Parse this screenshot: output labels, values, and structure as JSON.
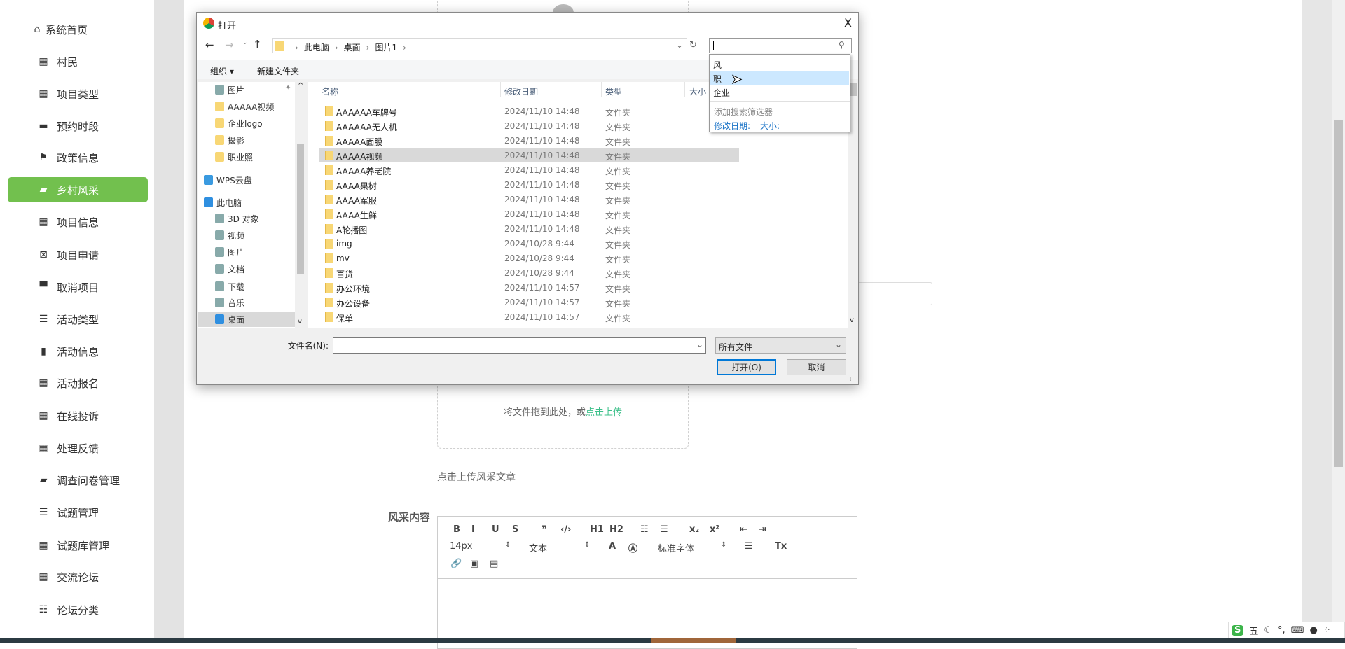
{
  "sidebar": {
    "items": [
      {
        "label": "系统首页",
        "icon": "home-icon",
        "glyph": "⌂"
      },
      {
        "label": "村民",
        "icon": "grid-icon",
        "glyph": "▦"
      },
      {
        "label": "项目类型",
        "icon": "grid-icon",
        "glyph": "▦"
      },
      {
        "label": "预约时段",
        "icon": "comment-icon",
        "glyph": "▬"
      },
      {
        "label": "政策信息",
        "icon": "flag-icon",
        "glyph": "⚑"
      },
      {
        "label": "乡村风采",
        "icon": "briefcase-icon",
        "glyph": "▰",
        "active": true
      },
      {
        "label": "项目信息",
        "icon": "grid-icon",
        "glyph": "▦"
      },
      {
        "label": "项目申请",
        "icon": "clipboard-x-icon",
        "glyph": "⊠"
      },
      {
        "label": "取消项目",
        "icon": "monitor-icon",
        "glyph": "▀"
      },
      {
        "label": "活动类型",
        "icon": "list-icon",
        "glyph": "☰"
      },
      {
        "label": "活动信息",
        "icon": "bar-chart-icon",
        "glyph": "▮"
      },
      {
        "label": "活动报名",
        "icon": "grid-icon",
        "glyph": "▦"
      },
      {
        "label": "在线投诉",
        "icon": "grid-icon",
        "glyph": "▦"
      },
      {
        "label": "处理反馈",
        "icon": "grid-icon",
        "glyph": "▦"
      },
      {
        "label": "调查问卷管理",
        "icon": "wallet-icon",
        "glyph": "▰"
      },
      {
        "label": "试题管理",
        "icon": "list-icon",
        "glyph": "☰"
      },
      {
        "label": "试题库管理",
        "icon": "grid-icon",
        "glyph": "▦"
      },
      {
        "label": "交流论坛",
        "icon": "grid-icon",
        "glyph": "▦"
      },
      {
        "label": "论坛分类",
        "icon": "sliders-icon",
        "glyph": "☷"
      }
    ]
  },
  "form": {
    "upload_hint": "将文件拖到此处，或",
    "upload_link": "点击上传",
    "article_upload": "点击上传风采文章",
    "content_label": "风采内容",
    "editor": {
      "font_size": "14px",
      "block_type": "文本",
      "font_family": "标准字体"
    },
    "accent": "#72c04e",
    "link_color": "#3cc08a"
  },
  "dialog": {
    "title": "打开",
    "close": "X",
    "breadcrumb": [
      "此电脑",
      "桌面",
      "图片1"
    ],
    "search_value": "",
    "toolbar": {
      "organize": "组织 ▾",
      "new_folder": "新建文件夹"
    },
    "nav": [
      {
        "label": "图片",
        "icon": "pictures-icon"
      },
      {
        "label": "AAAAA视频",
        "icon": "folder-icon"
      },
      {
        "label": "企业logo",
        "icon": "folder-icon"
      },
      {
        "label": "摄影",
        "icon": "folder-icon"
      },
      {
        "label": "职业照",
        "icon": "folder-icon"
      },
      {
        "label": "WPS云盘",
        "icon": "cloud-icon"
      },
      {
        "label": "此电脑",
        "icon": "computer-icon"
      },
      {
        "label": "3D 对象",
        "icon": "cube-icon"
      },
      {
        "label": "视频",
        "icon": "video-icon"
      },
      {
        "label": "图片",
        "icon": "pictures-icon"
      },
      {
        "label": "文档",
        "icon": "document-icon"
      },
      {
        "label": "下载",
        "icon": "download-icon"
      },
      {
        "label": "音乐",
        "icon": "music-icon"
      },
      {
        "label": "桌面",
        "icon": "desktop-icon",
        "selected": true
      }
    ],
    "columns": {
      "name": "名称",
      "date": "修改日期",
      "type": "类型",
      "size": "大小"
    },
    "files": [
      {
        "name": "AAAAAA车牌号",
        "date": "2024/11/10 14:48",
        "type": "文件夹"
      },
      {
        "name": "AAAAAA无人机",
        "date": "2024/11/10 14:48",
        "type": "文件夹"
      },
      {
        "name": "AAAAA面膜",
        "date": "2024/11/10 14:48",
        "type": "文件夹"
      },
      {
        "name": "AAAAA视频",
        "date": "2024/11/10 14:48",
        "type": "文件夹",
        "selected": true
      },
      {
        "name": "AAAAA养老院",
        "date": "2024/11/10 14:48",
        "type": "文件夹"
      },
      {
        "name": "AAAA果树",
        "date": "2024/11/10 14:48",
        "type": "文件夹"
      },
      {
        "name": "AAAA军服",
        "date": "2024/11/10 14:48",
        "type": "文件夹"
      },
      {
        "name": "AAAA生鲜",
        "date": "2024/11/10 14:48",
        "type": "文件夹"
      },
      {
        "name": "A轮播图",
        "date": "2024/11/10 14:48",
        "type": "文件夹"
      },
      {
        "name": "img",
        "date": "2024/10/28 9:44",
        "type": "文件夹"
      },
      {
        "name": "mv",
        "date": "2024/10/28 9:44",
        "type": "文件夹"
      },
      {
        "name": "百货",
        "date": "2024/10/28 9:44",
        "type": "文件夹"
      },
      {
        "name": "办公环境",
        "date": "2024/11/10 14:57",
        "type": "文件夹"
      },
      {
        "name": "办公设备",
        "date": "2024/11/10 14:57",
        "type": "文件夹"
      },
      {
        "name": "保单",
        "date": "2024/11/10 14:57",
        "type": "文件夹"
      }
    ],
    "search_suggestions": [
      "风",
      "职",
      "企业"
    ],
    "search_filter_title": "添加搜索筛选器",
    "search_filters": [
      "修改日期:",
      "大小:"
    ],
    "filename_label": "文件名(N):",
    "filename_value": "",
    "filetype": "所有文件",
    "open_button": "打开(O)",
    "cancel_button": "取消"
  },
  "ime": {
    "mode": "五"
  }
}
